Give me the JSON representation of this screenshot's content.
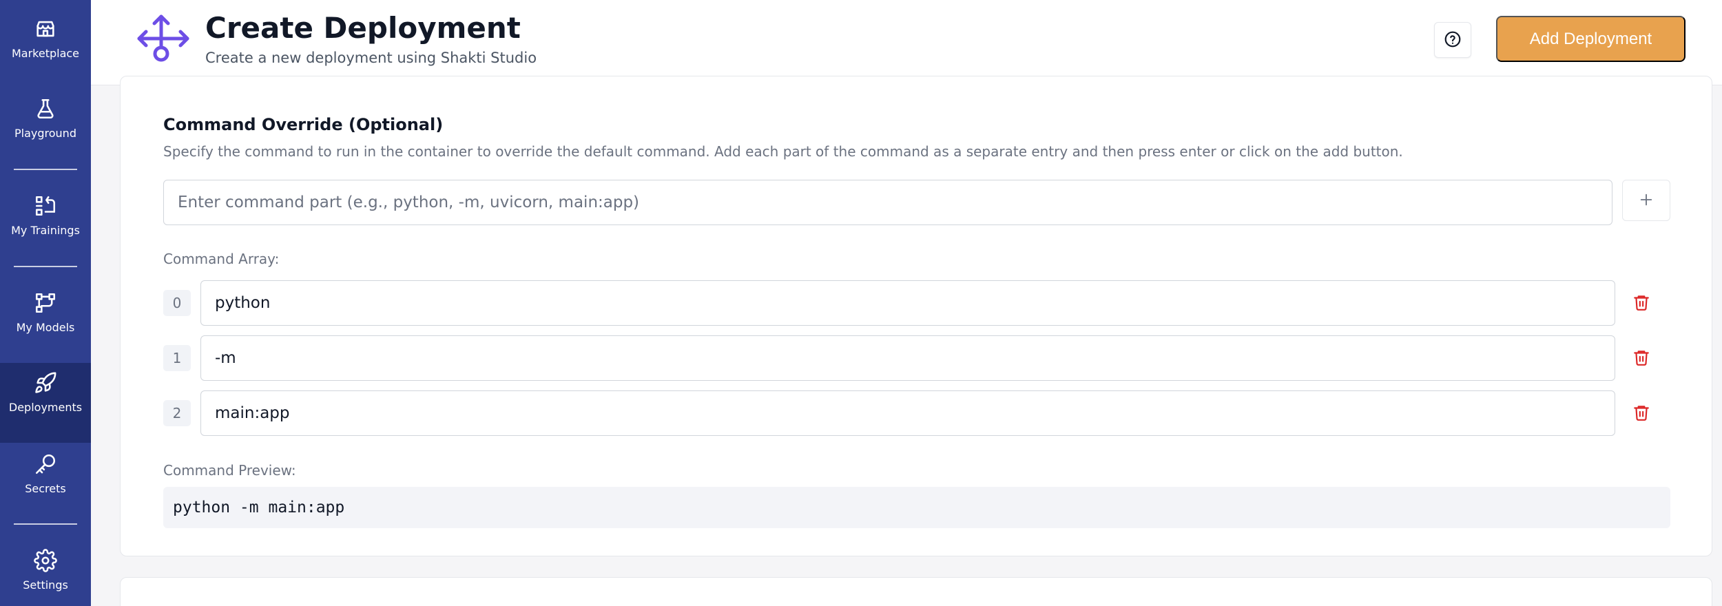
{
  "sidebar": {
    "items": [
      {
        "label": "Marketplace",
        "icon": "store-icon"
      },
      {
        "label": "Playground",
        "icon": "flask-icon"
      },
      {
        "label": "My Trainings",
        "icon": "trainings-icon"
      },
      {
        "label": "My Models",
        "icon": "models-icon"
      },
      {
        "label": "Deployments",
        "icon": "rocket-icon",
        "active": true
      },
      {
        "label": "Secrets",
        "icon": "key-icon"
      },
      {
        "label": "Settings",
        "icon": "gear-icon"
      }
    ]
  },
  "header": {
    "title": "Create Deployment",
    "subtitle": "Create a new deployment using Shakti Studio",
    "logo_icon": "deploy-arrows-icon",
    "help_icon": "question-circle-icon",
    "primary_button": "Add Deployment"
  },
  "command_override": {
    "title": "Command Override (Optional)",
    "description": "Specify the command to run in the container to override the default command. Add each part of the command as a separate entry and then press enter or click on the add button.",
    "input_placeholder": "Enter command part (e.g., python, -m, uvicorn, main:app)",
    "input_value": "",
    "add_icon": "plus-icon",
    "array_label": "Command Array:",
    "array": [
      {
        "index": "0",
        "value": "python"
      },
      {
        "index": "1",
        "value": "-m"
      },
      {
        "index": "2",
        "value": "main:app"
      }
    ],
    "delete_icon": "trash-icon",
    "preview_label": "Command Preview:",
    "preview": "python -m main:app"
  },
  "colors": {
    "sidebar_bg": "#2f3f8f",
    "sidebar_active": "#1f2d6e",
    "accent": "#e8a24e",
    "logo": "#6d4ee6",
    "danger": "#dc2626"
  }
}
